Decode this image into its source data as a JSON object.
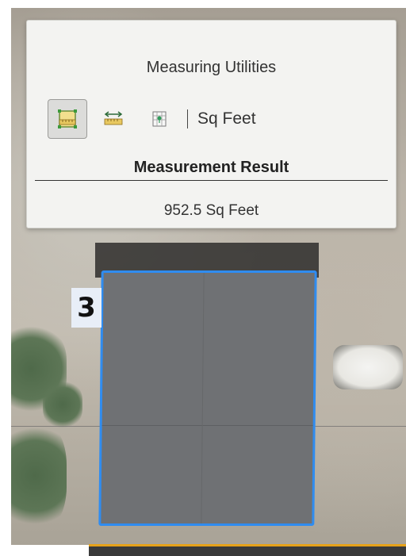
{
  "panel": {
    "title": "Measuring Utilities",
    "tools": [
      {
        "name": "area-tool",
        "active": true
      },
      {
        "name": "distance-tool",
        "active": false
      },
      {
        "name": "location-tool",
        "active": false
      }
    ],
    "unit": "Sq Feet",
    "result_heading": "Measurement Result",
    "result_value": "952.5 Sq Feet"
  },
  "map": {
    "lot_label": "3",
    "polygon_stroke_color": "#2f8cf0",
    "polygon_fill_color": "#6f7174"
  }
}
